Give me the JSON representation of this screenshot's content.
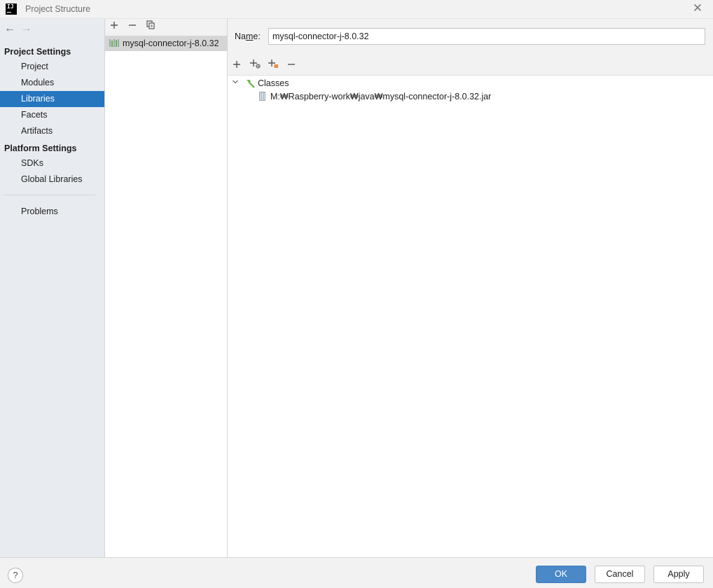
{
  "window": {
    "title": "Project Structure",
    "app_icon_text": "IJ"
  },
  "icons": {
    "close": "close-icon",
    "back": "arrow-left-icon",
    "forward": "arrow-right-icon",
    "add": "plus-icon",
    "remove": "minus-icon",
    "copy": "copy-icon",
    "library": "library-icon",
    "classes": "hammer-icon",
    "jar": "jar-file-icon",
    "help": "question-icon"
  },
  "sidebar": {
    "project_settings_header": "Project Settings",
    "project_items": [
      {
        "label": "Project"
      },
      {
        "label": "Modules"
      },
      {
        "label": "Libraries",
        "selected": true
      },
      {
        "label": "Facets"
      },
      {
        "label": "Artifacts"
      }
    ],
    "platform_settings_header": "Platform Settings",
    "platform_items": [
      {
        "label": "SDKs"
      },
      {
        "label": "Global Libraries"
      }
    ],
    "problems_label": "Problems"
  },
  "libraries": {
    "items": [
      {
        "label": "mysql-connector-j-8.0.32",
        "selected": true
      }
    ]
  },
  "details": {
    "name_label_prefix": "Na",
    "name_label_mnemonic": "m",
    "name_label_suffix": "e:",
    "name_value": "mysql-connector-j-8.0.32",
    "tree": {
      "root_label": "Classes",
      "expanded": true,
      "children": [
        {
          "label": "M:₩Raspberry-work₩java₩mysql-connector-j-8.0.32.jar"
        }
      ]
    }
  },
  "footer": {
    "help_symbol": "?",
    "ok_label": "OK",
    "cancel_label": "Cancel",
    "apply_label": "Apply"
  },
  "colors": {
    "selection": "#2675bf",
    "primary_button": "#4a88c7",
    "sidebar_bg": "#e8ebef",
    "list_selection": "#d5d5d5"
  }
}
